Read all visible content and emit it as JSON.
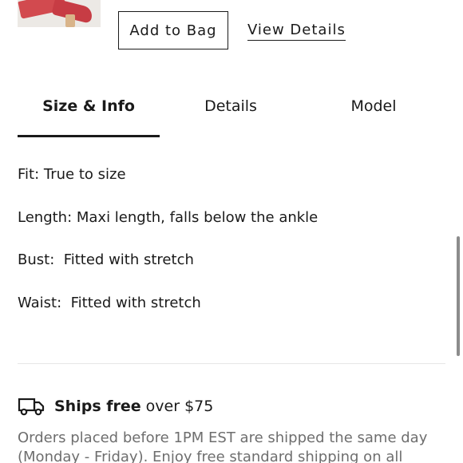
{
  "product": {
    "thumbnail_icon": "red-heeled-mules-image"
  },
  "actions": {
    "add_to_bag": "Add to Bag",
    "view_details": "View Details"
  },
  "tabs": [
    {
      "label": "Size & Info",
      "active": true
    },
    {
      "label": "Details",
      "active": false
    },
    {
      "label": "Model",
      "active": false
    }
  ],
  "size_info": [
    "Fit: True to size",
    "Length: Maxi length, falls below the ankle",
    "Bust:  Fitted with stretch",
    "Waist:  Fitted with stretch"
  ],
  "shipping": {
    "icon": "truck-icon",
    "bold_text": "Ships free",
    "text": "over $75",
    "description": "Orders placed before 1PM EST are shipped the same day (Monday - Friday). Enjoy free standard shipping on all"
  },
  "colors": {
    "text": "#1a1a1a",
    "muted": "#6e6e6e",
    "accent_shoe": "#d24a4f"
  }
}
